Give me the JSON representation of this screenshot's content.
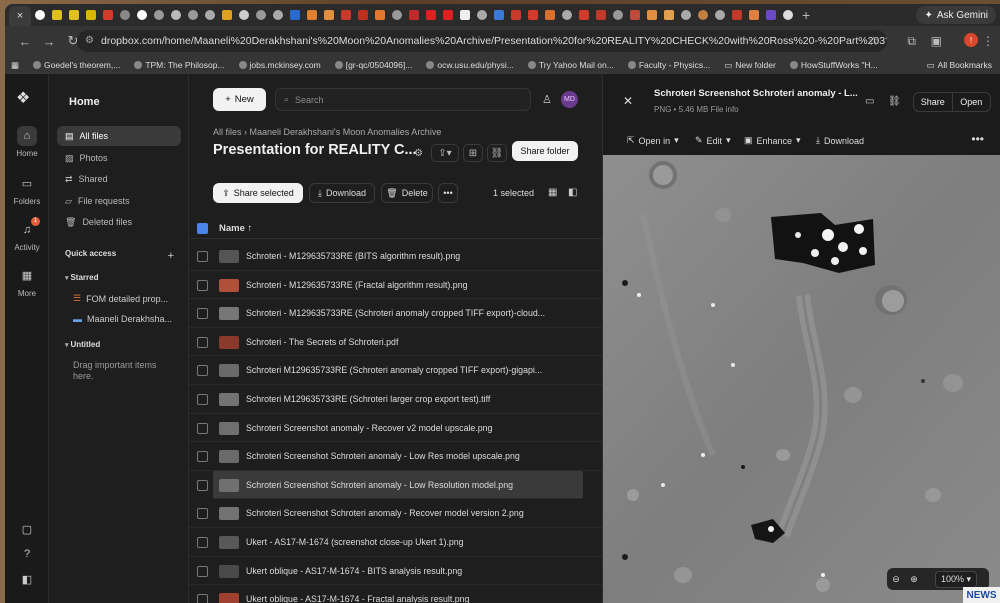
{
  "browser": {
    "tab_close": "×",
    "new_tab": "+",
    "gemini_label": "Ask Gemini",
    "url": "dropbox.com/home/Maaneli%20Derakhshani's%20Moon%20Anomalies%20Archive/Presentation%20for%20REALITY%20CHECK%20with%20Ross%20-%20Part%203?quickview=id%3AaYsT...",
    "avatar_letter": "!",
    "bookmarks": [
      "Goedel's theorem,...",
      "TPM: The Philosop...",
      "jobs.mckinsey.com",
      "[gr-qc/0504096]...",
      "ocw.usu.edu/physi...",
      "Try Yahoo Mail on...",
      "Faculty - Physics...",
      "New folder",
      "HowStuffWorks \"H..."
    ],
    "all_bookmarks": "All Bookmarks"
  },
  "rail": {
    "home": "Home",
    "folders": "Folders",
    "activity": "Activity",
    "activity_badge": "1",
    "more": "More"
  },
  "sidebar": {
    "title": "Home",
    "nav": [
      "All files",
      "Photos",
      "Shared",
      "File requests",
      "Deleted files"
    ],
    "quick_access": "Quick access",
    "starred": "Starred",
    "starred_items": [
      "FOM detailed prop...",
      "Maaneli Derakhsha..."
    ],
    "untitled": "Untitled",
    "drag_hint": "Drag important items here."
  },
  "main": {
    "new_label": "New",
    "search_placeholder": "Search",
    "user_initials": "MD",
    "breadcrumb": "All files  ›  Maaneli Derakhshani's Moon Anomalies Archive",
    "title": "Presentation for REALITY C...",
    "share_folder": "Share folder",
    "share_selected": "Share selected",
    "download": "Download",
    "delete": "Delete",
    "more": "•••",
    "selected_count": "1 selected",
    "col_name": "Name ↑"
  },
  "files": [
    {
      "name": "Schroteri - M129635733RE (BITS algorithm result).png",
      "thumb": "#555"
    },
    {
      "name": "Schroteri - M129635733RE (Fractal algorithm result).png",
      "thumb": "#b0503a"
    },
    {
      "name": "Schroteri - M129635733RE (Schroteri anomaly cropped TIFF export)-cloud...",
      "thumb": "#777"
    },
    {
      "name": "Schroteri - The Secrets of Schroteri.pdf",
      "thumb": "#8a3a2a"
    },
    {
      "name": "Schroteri M129635733RE (Schroteri anomaly cropped TIFF export)-gigapi...",
      "thumb": "#6a6a6a"
    },
    {
      "name": "Schroteri M129635733RE (Schroteri larger crop export test).tiff",
      "thumb": "#737373"
    },
    {
      "name": "Schroteri Screenshot anomaly - Recover v2 model upscale.png",
      "thumb": "#6f6f6f"
    },
    {
      "name": "Schroteri Screenshot Schroteri anomaly - Low Res model upscale.png",
      "thumb": "#6a6a6a"
    },
    {
      "name": "Schroteri Screenshot Schroteri anomaly - Low Resolution model.png",
      "thumb": "#707070",
      "selected": true
    },
    {
      "name": "Schroteri Screenshot Schroteri anomaly - Recover model version 2.png",
      "thumb": "#727272"
    },
    {
      "name": "Ukert - AS17-M-1674 (screenshot close-up Ukert 1).png",
      "thumb": "#585858"
    },
    {
      "name": "Ukert oblique - AS17-M-1674 - BITS analysis result.png",
      "thumb": "#4a4a4a"
    },
    {
      "name": "Ukert oblique - AS17-M-1674 - Fractal analysis result.png",
      "thumb": "#a0402e"
    }
  ],
  "preview": {
    "title": "Schroteri Screenshot Schroteri anomaly - L...",
    "subtitle": "PNG • 5.46 MB    File info",
    "share": "Share",
    "open": "Open",
    "open_in": "Open in",
    "edit": "Edit",
    "enhance": "Enhance",
    "download": "Download",
    "zoom": "100%"
  },
  "news_badge": "NEWS"
}
